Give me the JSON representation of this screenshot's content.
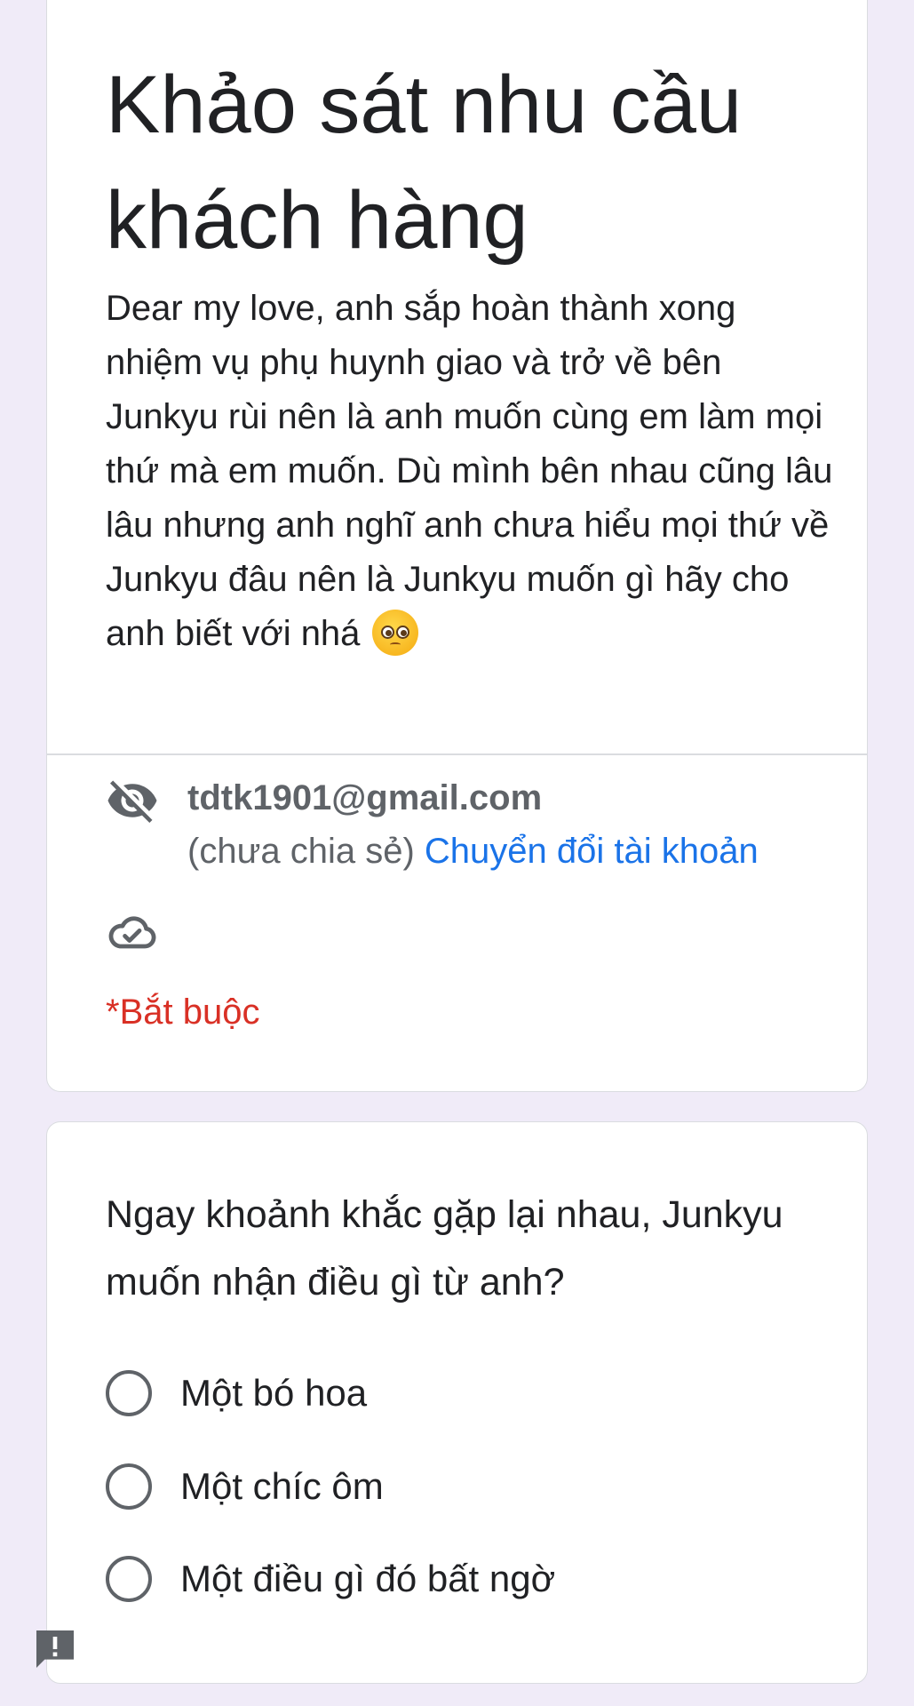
{
  "form": {
    "title": "Khảo sát nhu cầu khách hàng",
    "description": "Dear my love, anh sắp hoàn thành xong nhiệm vụ phụ huynh giao và trở về bên Junkyu rùi nên là anh muốn cùng em làm mọi thứ mà em muốn. Dù mình bên nhau cũng lâu lâu nhưng anh nghĩ anh chưa hiểu mọi thứ về Junkyu đâu nên là Junkyu muốn gì hãy cho anh biết với nhá",
    "description_emoji": "pleading-face"
  },
  "account": {
    "email": "tdtk1901@gmail.com",
    "share_status": "(chưa chia sẻ)",
    "switch_account_label": "Chuyển đổi tài khoản"
  },
  "required_note": "*Bắt buộc",
  "question": {
    "title": "Ngay khoảnh khắc gặp lại nhau, Junkyu muốn nhận điều gì từ anh?",
    "options": [
      {
        "label": "Một bó hoa"
      },
      {
        "label": "Một chíc ôm"
      },
      {
        "label": "Một điều gì đó bất ngờ"
      }
    ]
  },
  "icons": {
    "visibility": "eye-off-icon",
    "save_status": "cloud-done-icon",
    "feedback": "report-feedback-icon"
  },
  "colors": {
    "background": "#f0ebf8",
    "accent": "#673ab7",
    "link": "#1a73e8",
    "required": "#d93025"
  }
}
